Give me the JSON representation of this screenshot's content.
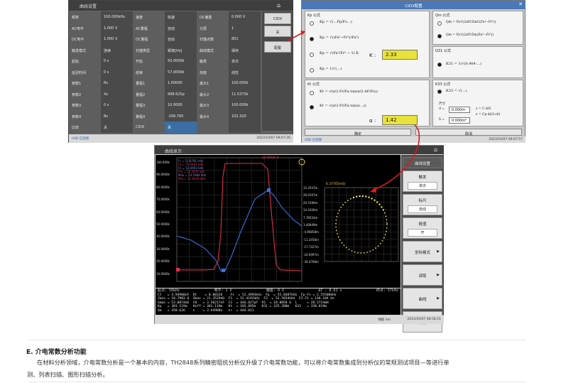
{
  "screen1": {
    "title": "曲线设置",
    "rows": [
      [
        "频率",
        "100.000kHz",
        "速度",
        "快速",
        "DC偏置",
        "0.000 V"
      ],
      [
        "AC电平",
        "1.000 V",
        "AC量程",
        "自动",
        "分屏",
        "1"
      ],
      [
        "DC电平",
        "1.000 V",
        "DC量程",
        "自动",
        "扫描点数",
        "801"
      ],
      [
        "触发模式",
        "连续",
        "扫描类型",
        "频率[Hz]",
        "曲线模式",
        "保存"
      ],
      [
        "起始",
        "0 s",
        "开始",
        "50.0000k",
        "触发",
        "单次"
      ],
      [
        "延迟时间",
        "0 s",
        "结束",
        "57.0000k",
        "刻度",
        "线性"
      ],
      [
        "参数1",
        "Rs",
        "量程1",
        "1.00000",
        "最大1",
        "100.000k"
      ],
      [
        "参数2",
        "Xs",
        "量程2",
        "998.625p",
        "最大2",
        "11.5373k"
      ],
      [
        "参数3",
        "0 s",
        "量程3",
        "10.0000",
        "最大3",
        "100.000k"
      ],
      [
        "参数4",
        "Bs",
        "量程4",
        "-106.765",
        "最大4",
        "102.320"
      ],
      [
        "比较",
        "关",
        "CIDX",
        "关",
        "",
        ""
      ]
    ],
    "side_buttons": [
      "CIDX",
      "关",
      "配置"
    ],
    "status": "USB 已连接",
    "status_right": "2023/10/07 09:07:26"
  },
  "dialog": {
    "title": "CIDX配置",
    "kp_title": "Kp 公式",
    "qm_title": "Qm 公式",
    "q31_title": "Q31 公式",
    "kt_title": "Kt 公式",
    "k33_title": "K33 公式",
    "k_label": "K :",
    "k_value": "2.33",
    "alpha_label": "α :",
    "alpha_value": "1.42",
    "size_label": "尺寸",
    "d_label": "d =",
    "d_value": "0.000m",
    "s_label": "S =",
    "s_value": "0.000m²",
    "ok": "确定",
    "cancel": "取消",
    "status": "USB 已连接",
    "status_right": "2023/10/07 09:07:57",
    "formulas": {
      "kp1": "Kp = √(…Fp/Fs…)",
      "kp2": "Kp = √((Fa²−Fr²)/Fa²)",
      "kp3": "Kp = √(Fa²/Fr² − 1)·K",
      "kp4": "Kp = 1/√(…)",
      "qm1": "Qm = Fa²/(2πFrZmC(Fa²−Fr²))",
      "qm2": "Qm = Fa²/(2πFrZm(Fa²−Fr²))",
      "q31": "K31 = 1/√(0.404·…)",
      "kt1": "Kt = √(π/2·Fr/Fa·tan(π/2·ΔF/Fa))",
      "kt2": "Kt = √(π/2·Fr/Fa·tan(α…))",
      "k33": "K33 = √(…)",
      "dformula1": "ε = C·d/S",
      "dformula2": "ε = Cp·d/(S·ε0)"
    }
  },
  "screen2": {
    "title": "曲线显示",
    "legend": [
      "Fr = 51.6791 kHz",
      "Fa = 55.0487 kHz",
      "Fs = 52.4993 kHz",
      "Fm = 52.5659 kHz",
      "Max = 53.5984 kHz",
      "Min = 51.8049 kHz"
    ],
    "cursor_value": "25.8956 %",
    "y_ticks": [
      "100.000k",
      "90.0000k",
      "80.0000k",
      "70.0000k",
      "60.0000k",
      "50.0000k",
      "40.0000k",
      "30.0000k",
      "20.0000k",
      "10.0000k"
    ],
    "circle_ticks": [
      "33.2937m",
      "26.9167m",
      "20.5396m",
      "14.1626m",
      "7.78554m",
      "1.40849m",
      "-4.96858m",
      "-11.3456m",
      "-17.7227m",
      "-24.0997m",
      "-30.4768m"
    ],
    "circle_label": "6.37705mS/",
    "right_buttons": [
      {
        "label": "曲线设置",
        "sub": ""
      },
      {
        "label": "触发",
        "sub": "单次"
      },
      {
        "label": "标尺",
        "sub": "自动"
      },
      {
        "label": "极值",
        "sub": "开"
      },
      {
        "label": "坐标格式",
        "sub": ""
      },
      {
        "label": "读取",
        "sub": ""
      },
      {
        "label": "曲线",
        "sub": ""
      },
      {
        "label": "保存",
        "sub": ""
      }
    ],
    "axis_line": [
      "起点: 50kHz",
      "电平: 1 V",
      "偏置: 0 V",
      "ΔT : 8.61 s",
      "终点: 57kHz"
    ],
    "readout": [
      "Ct   = 3.94900nF  Dt    = 0.00326    Fs  = 52.4993kHz  Fp  = 55.0487kHz  Fp-Fs = 2.55500kHz",
      "Zmin = 18.7903 Ω  Zmax = 21.3529kΩ  F1  = 52.4192kHz  F2  = 52.5654kHz  F2-F1 = 146.184 Hz",
      "Gmax = 53.0874mS  C0   = 3.50217nF  C1  = 446.827pF  R1  = 18.8058 Ω  L     = 20.5724mH",
      "Kp   = 301.119m   Keff = 301.119m   Kt  = 105.895m   K31 = 335.288m   K33   = 330.819m",
      "Qm   = 450.626    ε    = 3.94900n   εr  = 446.013"
    ],
    "status": "线缆 0m",
    "status_right": "2023/10/07 08:58:21"
  },
  "article": {
    "section_title": "E. 介电常数分析功能",
    "para_line1": "在材料分析领域，介电常数分析是一个基本的内容，TH2848系列精密阻抗分析仪升级了介电常数功能，可以将介电常数集成到分析仪的常规测试项目—等进行单",
    "para_line2": "测、列表扫描、图形扫描分析。"
  }
}
